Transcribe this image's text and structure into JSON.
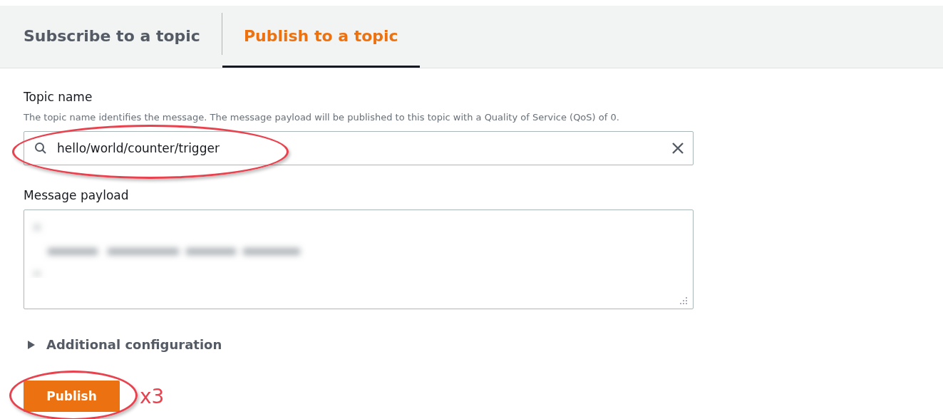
{
  "tabs": [
    {
      "label": "Subscribe to a topic",
      "selected": false
    },
    {
      "label": "Publish to a topic",
      "selected": true
    }
  ],
  "topic_name": {
    "label": "Topic name",
    "description": "The topic name identifies the message. The message payload will be published to this topic with a Quality of Service (QoS) of 0.",
    "value": "hello/world/counter/trigger",
    "highlighted": true
  },
  "message_payload": {
    "label": "Message payload"
  },
  "additional_configuration": {
    "label": "Additional configuration",
    "expanded": false
  },
  "publish_button": {
    "label": "Publish",
    "highlighted": true,
    "annotation": "x3"
  }
}
